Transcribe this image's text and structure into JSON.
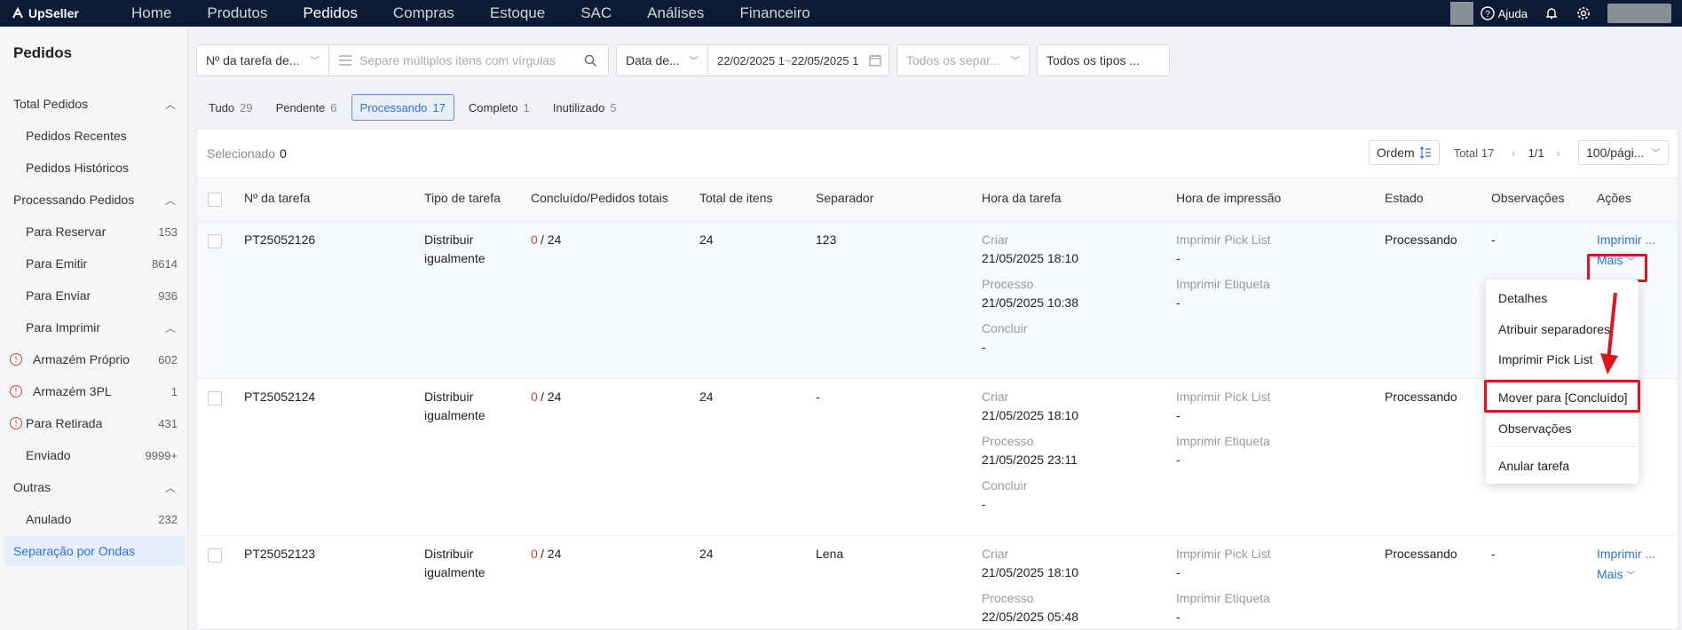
{
  "topnav": {
    "brand": "UpSeller",
    "items": [
      "Home",
      "Produtos",
      "Pedidos",
      "Compras",
      "Estoque",
      "SAC",
      "Análises",
      "Financeiro"
    ],
    "active_index": 2,
    "help_label": "Ajuda"
  },
  "sidebar": {
    "title": "Pedidos",
    "groups": {
      "total": "Total Pedidos",
      "recentes": "Pedidos Recentes",
      "historicos": "Pedidos Históricos",
      "processando": "Processando Pedidos",
      "reservar": {
        "label": "Para Reservar",
        "count": "153"
      },
      "emitir": {
        "label": "Para Emitir",
        "count": "8614"
      },
      "enviar": {
        "label": "Para Enviar",
        "count": "936"
      },
      "imprimir": "Para Imprimir",
      "proprio": {
        "label": "Armazém Próprio",
        "count": "602"
      },
      "tpl": {
        "label": "Armazém 3PL",
        "count": "1"
      },
      "retirada": {
        "label": "Para Retirada",
        "count": "431"
      },
      "enviado": {
        "label": "Enviado",
        "count": "9999+"
      },
      "outras": "Outras",
      "anulado": {
        "label": "Anulado",
        "count": "232"
      },
      "ondas": "Separação por Ondas"
    }
  },
  "filters": {
    "task_no": "Nº da tarefa de...",
    "search_placeholder": "Separe múltiplos itens com vírgulas",
    "date_type": "Data de...",
    "date_start": "22/02/2025 1",
    "date_sep": "~",
    "date_end": "22/05/2025 1",
    "separators_placeholder": "Todos os separ...",
    "types": "Todos os tipos ..."
  },
  "tabs": [
    {
      "label": "Tudo",
      "count": "29"
    },
    {
      "label": "Pendente",
      "count": "6"
    },
    {
      "label": "Processando",
      "count": "17"
    },
    {
      "label": "Completo",
      "count": "1"
    },
    {
      "label": "Inutilizado",
      "count": "5"
    }
  ],
  "toolbar": {
    "selected_label": "Selecionado",
    "selected_count": "0",
    "order_label": "Ordem",
    "total": "Total 17",
    "page": "1/1",
    "per_page": "100/pági..."
  },
  "columns": [
    "Nº da tarefa",
    "Tipo de tarefa",
    "Concluído/Pedidos totais",
    "Total de itens",
    "Separador",
    "Hora da tarefa",
    "Hora de impressão",
    "Estado",
    "Observações",
    "Ações"
  ],
  "labels": {
    "criar": "Criar",
    "processo": "Processo",
    "concluir": "Concluir",
    "pick": "Imprimir Pick List",
    "etiqueta": "Imprimir Etiqueta",
    "dash": "-",
    "action_print": "Imprimir ...",
    "action_more": "Mais",
    "slash_total": "/ 24"
  },
  "rows": [
    {
      "id": "PT25052126",
      "type1": "Distribuir",
      "type2": "igualmente",
      "done": "0",
      "items": "24",
      "separator": "123",
      "created": "21/05/2025 18:10",
      "process": "21/05/2025 10:38",
      "conclude": "-",
      "pick": "-",
      "label": "-",
      "state": "Processando",
      "notes": "-"
    },
    {
      "id": "PT25052124",
      "type1": "Distribuir",
      "type2": "igualmente",
      "done": "0",
      "items": "24",
      "separator": "-",
      "created": "21/05/2025 18:10",
      "process": "21/05/2025 23:11",
      "conclude": "-",
      "pick": "-",
      "label": "-",
      "state": "Processando",
      "notes": "-"
    },
    {
      "id": "PT25052123",
      "type1": "Distribuir",
      "type2": "igualmente",
      "done": "0",
      "items": "24",
      "separator": "Lena",
      "created": "21/05/2025 18:10",
      "process": "22/05/2025 05:48",
      "conclude": "",
      "pick": "-",
      "label": "-",
      "state": "Processando",
      "notes": "-"
    }
  ],
  "dropdown": {
    "items": [
      "Detalhes",
      "Atribuir separadores",
      "Imprimir Pick List",
      "Mover para [Concluído]",
      "Observações",
      "Anular tarefa"
    ]
  },
  "colors": {
    "accent": "#2f6fe4",
    "nav_bg": "#0a1b33",
    "highlight": "#e0141e"
  }
}
